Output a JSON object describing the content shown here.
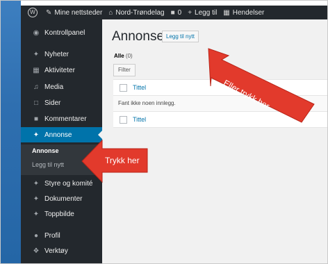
{
  "adminbar": {
    "logo": "W",
    "sites": "Mine nettsteder",
    "site_name": "Nord-Trøndelag",
    "comments_count": "0",
    "new_label": "Legg til",
    "events": "Hendelser"
  },
  "sidebar": {
    "items": [
      {
        "label": "Kontrollpanel",
        "icon": "dashboard-icon"
      },
      {
        "label": "Nyheter",
        "icon": "pin-icon"
      },
      {
        "label": "Aktiviteter",
        "icon": "calendar-icon"
      },
      {
        "label": "Media",
        "icon": "media-icon"
      },
      {
        "label": "Sider",
        "icon": "page-icon"
      },
      {
        "label": "Kommentarer",
        "icon": "comment-icon"
      },
      {
        "label": "Annonse",
        "icon": "pin-icon"
      },
      {
        "label": "Styre og komité",
        "icon": "pin-icon"
      },
      {
        "label": "Dokumenter",
        "icon": "pin-icon"
      },
      {
        "label": "Toppbilde",
        "icon": "pin-icon"
      },
      {
        "label": "Profil",
        "icon": "user-icon"
      },
      {
        "label": "Verktøy",
        "icon": "wrench-icon"
      }
    ],
    "submenu": {
      "current": "Annonse",
      "add_new": "Legg til nytt"
    }
  },
  "main": {
    "title": "Annonse",
    "add_new_button": "Legg til nytt",
    "filter_all_label": "Alle",
    "filter_all_count": "(0)",
    "filter_button": "Filter",
    "column_title": "Tittel",
    "empty_message": "Fant ikke noen innlegg."
  },
  "annotations": {
    "top_callout": "Eller trykk her",
    "left_callout": "Trykk her",
    "arrow_color": "#e23a2c"
  }
}
